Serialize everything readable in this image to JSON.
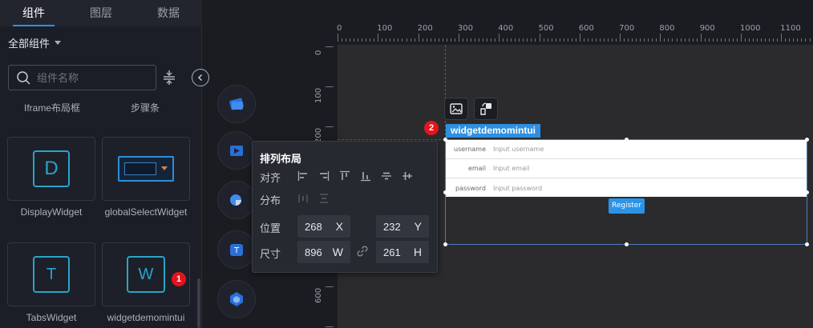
{
  "tabs": [
    {
      "label": "组件",
      "active": true
    },
    {
      "label": "图层",
      "active": false
    },
    {
      "label": "数据",
      "active": false
    }
  ],
  "category": {
    "label": "全部组件"
  },
  "search": {
    "placeholder": "组件名称"
  },
  "top_labels": {
    "iframe": "Iframe布局框",
    "steps": "步骤条"
  },
  "components": [
    {
      "name": "DisplayWidget",
      "letter": "D"
    },
    {
      "name": "globalSelectWidget",
      "letter": ""
    },
    {
      "name": "TabsWidget",
      "letter": "T"
    },
    {
      "name": "widgetdemomintui",
      "letter": "W"
    }
  ],
  "badges": {
    "one": "1",
    "two": "2"
  },
  "ruler": {
    "x_ticks": [
      "0",
      "100",
      "200",
      "300",
      "400",
      "500",
      "600",
      "700",
      "800",
      "900",
      "1000",
      "1100"
    ],
    "y_ticks": [
      "0",
      "100",
      "200",
      "600",
      "700"
    ]
  },
  "widget": {
    "tag": "widgetdemomintui",
    "fields": [
      {
        "label": "username",
        "placeholder": "Input username"
      },
      {
        "label": "email",
        "placeholder": "Input email"
      },
      {
        "label": "password",
        "placeholder": "Input password"
      }
    ],
    "button": "Register"
  },
  "popup": {
    "title": "排列布局",
    "align_label": "对齐",
    "distribute_label": "分布",
    "position_label": "位置",
    "size_label": "尺寸",
    "x_value": "268",
    "x_unit": "X",
    "y_value": "232",
    "y_unit": "Y",
    "w_value": "896",
    "w_unit": "W",
    "h_value": "261",
    "h_unit": "H"
  },
  "colors": {
    "accent": "#2f8ff2",
    "badge": "#e4141c",
    "guide": "#e02424"
  }
}
